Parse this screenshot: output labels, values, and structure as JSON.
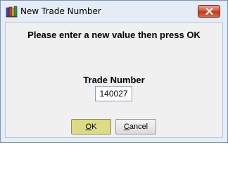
{
  "window": {
    "title": "New Trade Number",
    "app_icon": "books-icon",
    "close_icon": "close-icon"
  },
  "dialog": {
    "prompt": "Please enter a new value then press OK",
    "field_label": "Trade Number",
    "field_value": "140027"
  },
  "buttons": {
    "ok_mnemonic": "O",
    "ok_rest": "K",
    "cancel_mnemonic": "C",
    "cancel_rest": "ancel"
  },
  "colors": {
    "ok_button_bg": "#dcdc84",
    "close_button": "#c23a1c"
  }
}
